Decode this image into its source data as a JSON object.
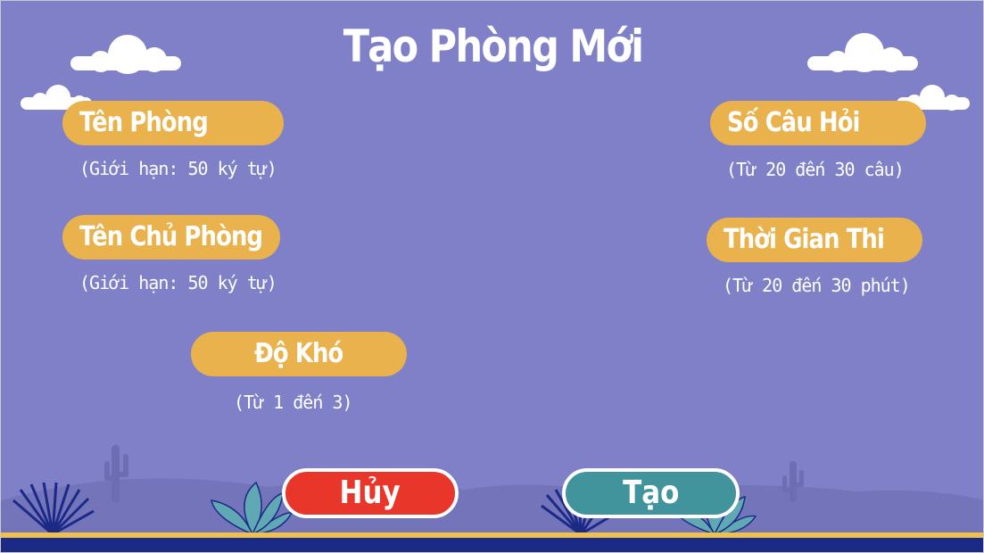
{
  "title": "Tạo Phòng Mới",
  "fields": {
    "room_name": {
      "label": "Tên Phòng",
      "hint": "(Giới hạn: 50 ký tự)"
    },
    "host_name": {
      "label": "Tên Chủ Phòng",
      "hint": "(Giới hạn: 50 ký tự)"
    },
    "difficulty": {
      "label": "Độ Khó",
      "hint": "(Từ 1 đến 3)"
    },
    "question_count": {
      "label": "Số Câu Hỏi",
      "hint": "(Từ 20 đến 30 câu)"
    },
    "exam_time": {
      "label": "Thời Gian Thi",
      "hint": "(Từ 20 đến 30 phút)"
    }
  },
  "buttons": {
    "cancel": "Hủy",
    "create": "Tạo"
  },
  "colors": {
    "background": "#7f80c8",
    "label_pill": "#e9b24c",
    "cancel_button": "#e8372a",
    "create_button": "#41939c",
    "ground_stripe": "#f0c04c",
    "ground_base": "#1b2a86"
  },
  "icons": [
    "cloud-icon",
    "cactus-icon",
    "plant-icon"
  ]
}
